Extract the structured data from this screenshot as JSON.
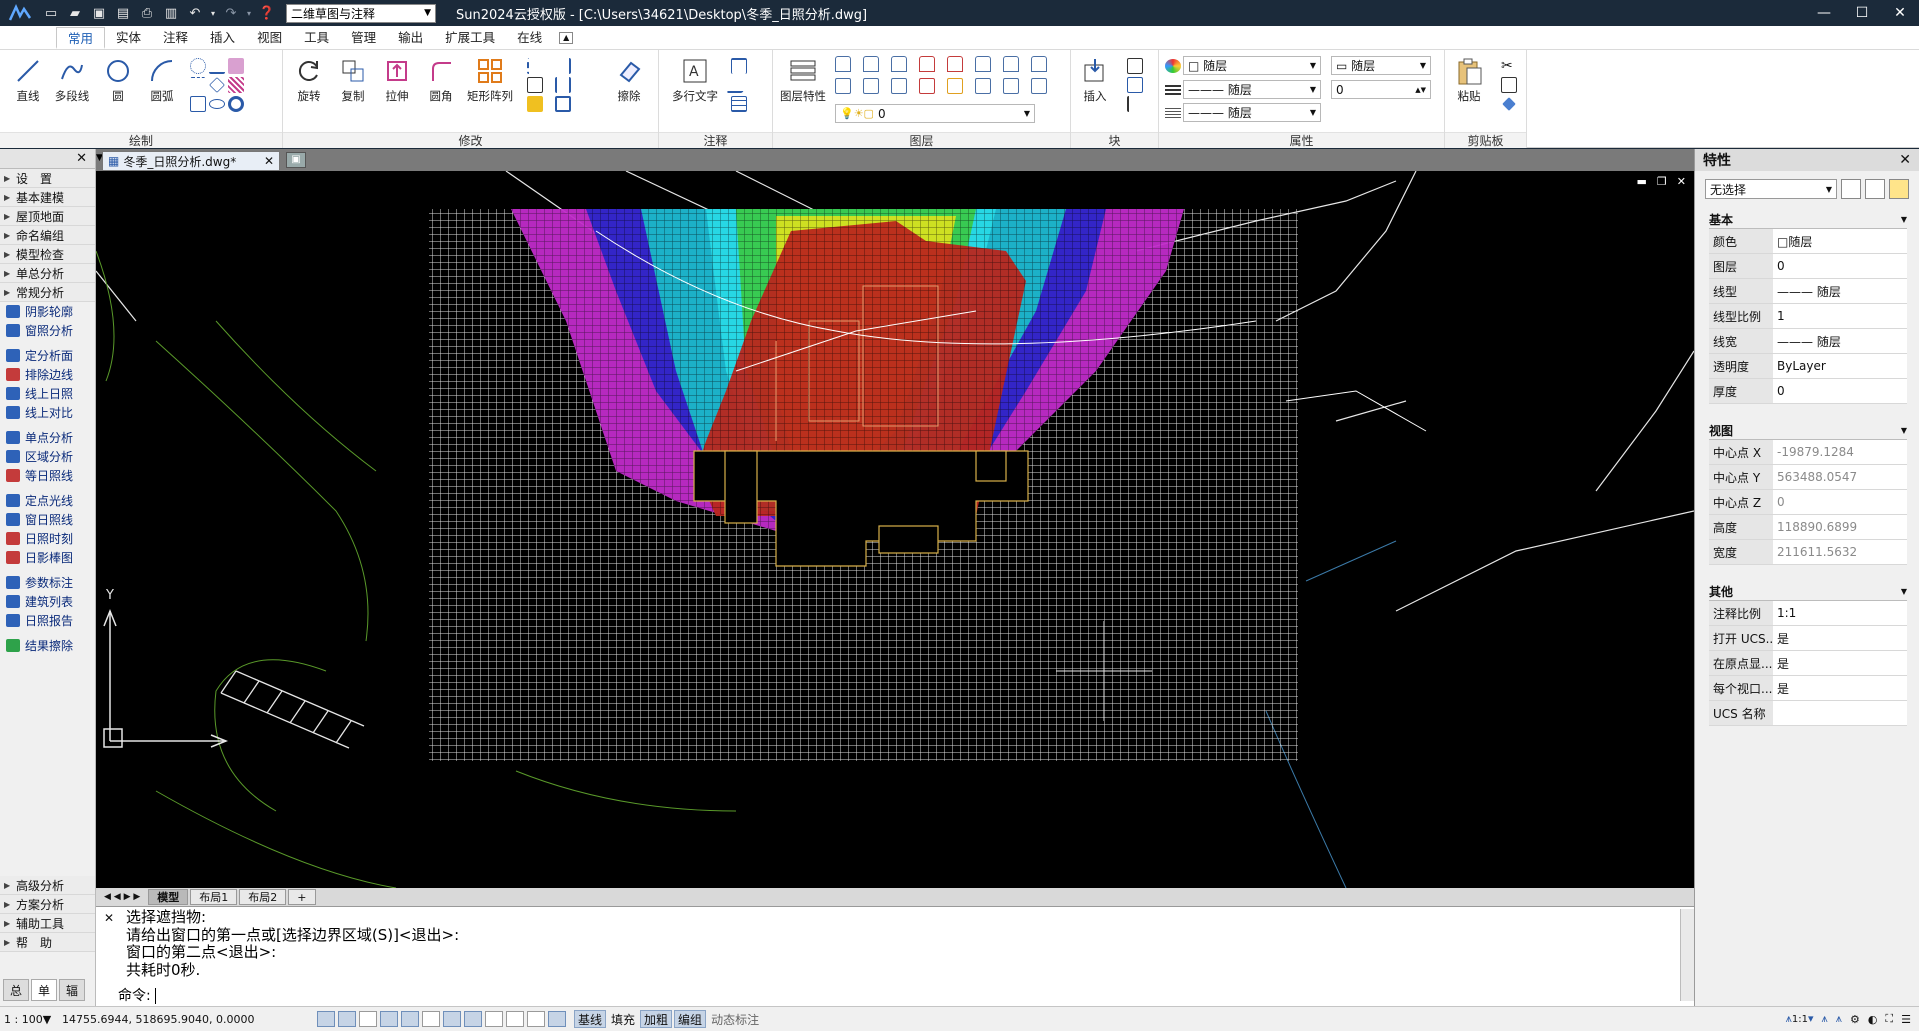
{
  "titlebar": {
    "workspace": "二维草图与注释",
    "title": "Sun2024云授权版 - [C:\\Users\\34621\\Desktop\\冬季_日照分析.dwg]"
  },
  "ribbon_tabs": [
    "常用",
    "实体",
    "注释",
    "插入",
    "视图",
    "工具",
    "管理",
    "输出",
    "扩展工具",
    "在线"
  ],
  "panels": {
    "draw": {
      "title": "绘制",
      "buttons": [
        "直线",
        "多段线",
        "圆",
        "圆弧"
      ]
    },
    "modify": {
      "title": "修改",
      "buttons": [
        "旋转",
        "复制",
        "拉伸",
        "圆角",
        "矩形阵列",
        "擦除"
      ]
    },
    "annotate": {
      "title": "注释",
      "buttons": [
        "多行文字"
      ]
    },
    "layer": {
      "title": "图层",
      "buttons": [
        "图层特性"
      ],
      "current": "0"
    },
    "block": {
      "title": "块",
      "buttons": [
        "插入"
      ]
    },
    "props": {
      "title": "属性",
      "color": "随层",
      "linetype": "随层",
      "lineweight": "随层",
      "plotstyle": "随层",
      "value": "0"
    },
    "clipboard": {
      "title": "剪贴板",
      "buttons": [
        "粘贴"
      ]
    }
  },
  "document_tab": "冬季_日照分析.dwg*",
  "left_palette": {
    "categories_top": [
      "设　置",
      "基本建模",
      "屋顶地面",
      "命名编组",
      "模型检查",
      "单总分析",
      "常规分析"
    ],
    "items": [
      {
        "label": "阴影轮廓",
        "color": "#2e62b8"
      },
      {
        "label": "窗照分析",
        "color": "#2e62b8"
      },
      {
        "label": "定分析面",
        "color": "#2e62b8"
      },
      {
        "label": "排除边线",
        "color": "#c43b3b"
      },
      {
        "label": "线上日照",
        "color": "#2e62b8"
      },
      {
        "label": "线上对比",
        "color": "#2e62b8"
      },
      {
        "label": "单点分析",
        "color": "#2e62b8"
      },
      {
        "label": "区域分析",
        "color": "#2e62b8"
      },
      {
        "label": "等日照线",
        "color": "#c43b3b"
      },
      {
        "label": "定点光线",
        "color": "#2e62b8"
      },
      {
        "label": "窗日照线",
        "color": "#2e62b8"
      },
      {
        "label": "日照时刻",
        "color": "#c43b3b"
      },
      {
        "label": "日影棒图",
        "color": "#c43b3b"
      },
      {
        "label": "参数标注",
        "color": "#2e62b8"
      },
      {
        "label": "建筑列表",
        "color": "#2e62b8"
      },
      {
        "label": "日照报告",
        "color": "#2e62b8"
      },
      {
        "label": "结果擦除",
        "color": "#2ea24a"
      }
    ],
    "categories_bottom": [
      "高级分析",
      "方案分析",
      "辅助工具",
      "帮　助"
    ],
    "bottom_tabs": [
      "总",
      "单",
      "辐"
    ]
  },
  "layout_tabs": [
    "模型",
    "布局1",
    "布局2",
    "+"
  ],
  "command": {
    "lines": [
      "选择遮挡物:",
      "请给出窗口的第一点或[选择边界区域(S)]<退出>:",
      "窗口的第二点<退出>:",
      "共耗时0秒."
    ],
    "prompt": "命令:"
  },
  "status": {
    "scale": "1 : 100",
    "coords": "14755.6944, 518695.9040, 0.0000",
    "toggles": [
      "基线",
      "填充",
      "加粗",
      "编组",
      "动态标注"
    ],
    "anno_scale": "1:1"
  },
  "properties": {
    "title": "特性",
    "selection": "无选择",
    "sections": [
      {
        "name": "基本",
        "rows": [
          [
            "颜色",
            "□随层"
          ],
          [
            "图层",
            "0"
          ],
          [
            "线型",
            "——— 随层"
          ],
          [
            "线型比例",
            "1"
          ],
          [
            "线宽",
            "——— 随层"
          ],
          [
            "透明度",
            "ByLayer"
          ],
          [
            "厚度",
            "0"
          ]
        ]
      },
      {
        "name": "视图",
        "rows": [
          [
            "中心点 X",
            "-19879.1284"
          ],
          [
            "中心点 Y",
            "563488.0547"
          ],
          [
            "中心点 Z",
            "0"
          ],
          [
            "高度",
            "118890.6899"
          ],
          [
            "宽度",
            "211611.5632"
          ]
        ]
      },
      {
        "name": "其他",
        "rows": [
          [
            "注释比例",
            "1:1"
          ],
          [
            "打开 UCS...",
            "是"
          ],
          [
            "在原点显...",
            "是"
          ],
          [
            "每个视口...",
            "是"
          ],
          [
            "UCS 名称",
            ""
          ]
        ]
      }
    ]
  },
  "colors": {
    "accent": "#1e5fb5",
    "titlebar": "#1b2a3a",
    "canvas": "#000000"
  }
}
